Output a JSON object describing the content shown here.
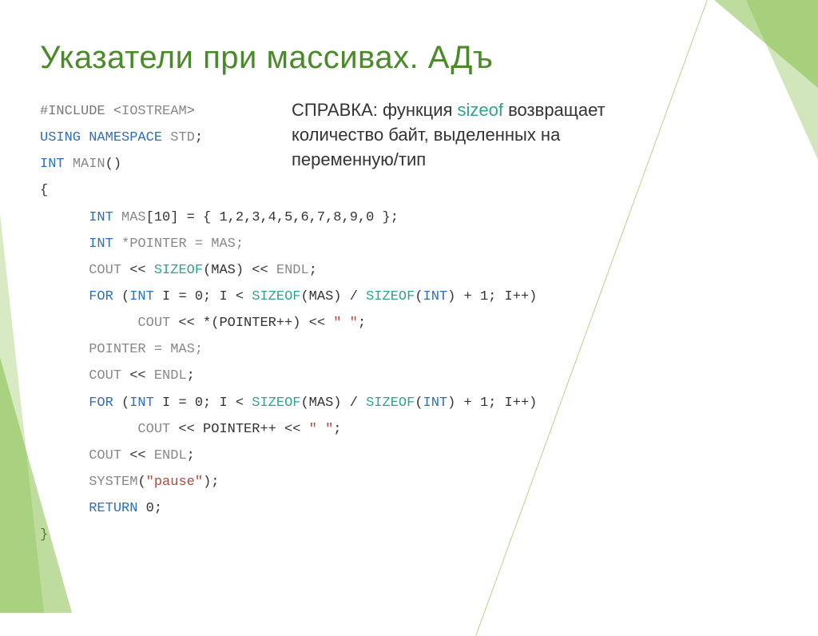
{
  "title": "Указатели при массивах. АДъ",
  "note": {
    "prefix": "СПРАВКА: функция ",
    "sizeof": "sizeof",
    "rest1": " возвращает количество байт, выделенных на переменную/тип"
  },
  "code": {
    "l1_include": "#INCLUDE",
    "l1_iostream": "IOSTREAM",
    "l2_using": "USING",
    "l2_namespace": "NAMESPACE",
    "l2_std": "STD",
    "l3_int": "INT",
    "l3_main": "MAIN",
    "l4_brace": "{",
    "l5_int": "INT",
    "l5_decl": "MAS",
    "l5_size": "10",
    "l5_vals": "= { 1,2,3,4,5,6,7,8,9,0 };",
    "l6_int": "INT",
    "l6_rest": "*POINTER = MAS;",
    "l7_cout": "COUT",
    "l7_sizeof": "SIZEOF",
    "l7_endl": "ENDL",
    "l8_for": "FOR",
    "l8_int": "INT",
    "l8_sizeof": "SIZEOF",
    "l8_int2": "INT",
    "l9_cout": "COUT",
    "l10_rest": "POINTER = MAS;",
    "l11_cout": "COUT",
    "l11_endl": "ENDL",
    "l12_for": "FOR",
    "l12_int": "INT",
    "l12_sizeof": "SIZEOF",
    "l12_int2": "INT",
    "l13_cout": "COUT",
    "l14_cout": "COUT",
    "l14_endl": "ENDL",
    "l15_system": "SYSTEM",
    "l15_pause": "\"pause\"",
    "l16_return": "RETURN",
    "l17_brace": "}"
  }
}
